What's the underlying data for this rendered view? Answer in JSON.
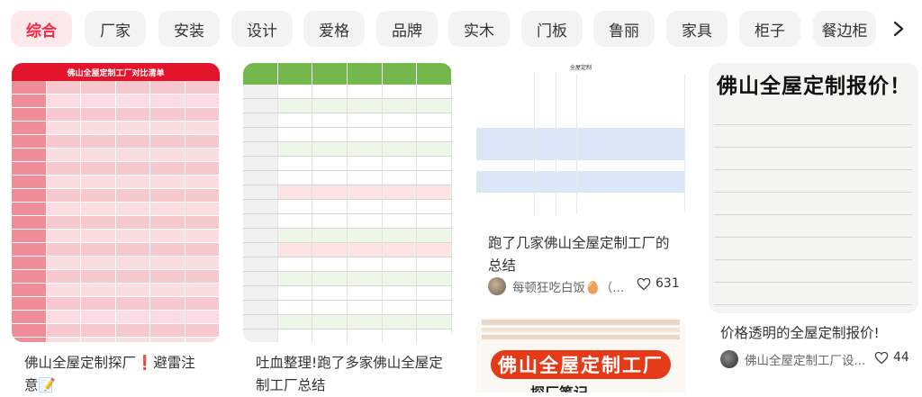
{
  "tabs": [
    "综合",
    "厂家",
    "安装",
    "设计",
    "爱格",
    "品牌",
    "实木",
    "门板",
    "鲁丽",
    "家具",
    "柜子",
    "餐边柜"
  ],
  "active_tab": "综合",
  "cards": [
    {
      "title": "佛山全屋定制探厂❗️避雷注意📝",
      "thumb_title": "佛山全屋定制工厂对比清单"
    },
    {
      "title": "吐血整理!跑了多家佛山全屋定制工厂总结"
    },
    {
      "title": "跑了几家佛山全屋定制工厂的总结",
      "author": "每顿狂吃白饭🥚（...",
      "likes": "631",
      "thumb_title": "全屋定制"
    },
    {
      "thumb_text": "佛山全屋定制工厂",
      "thumb_sub": "探厂笔记"
    },
    {
      "title": "价格透明的全屋定制报价!",
      "author": "佛山全屋定制工厂设...",
      "likes": "44",
      "thumb_title": "佛山全屋定制报价！"
    }
  ],
  "colors": {
    "accent": "#ff2442"
  }
}
